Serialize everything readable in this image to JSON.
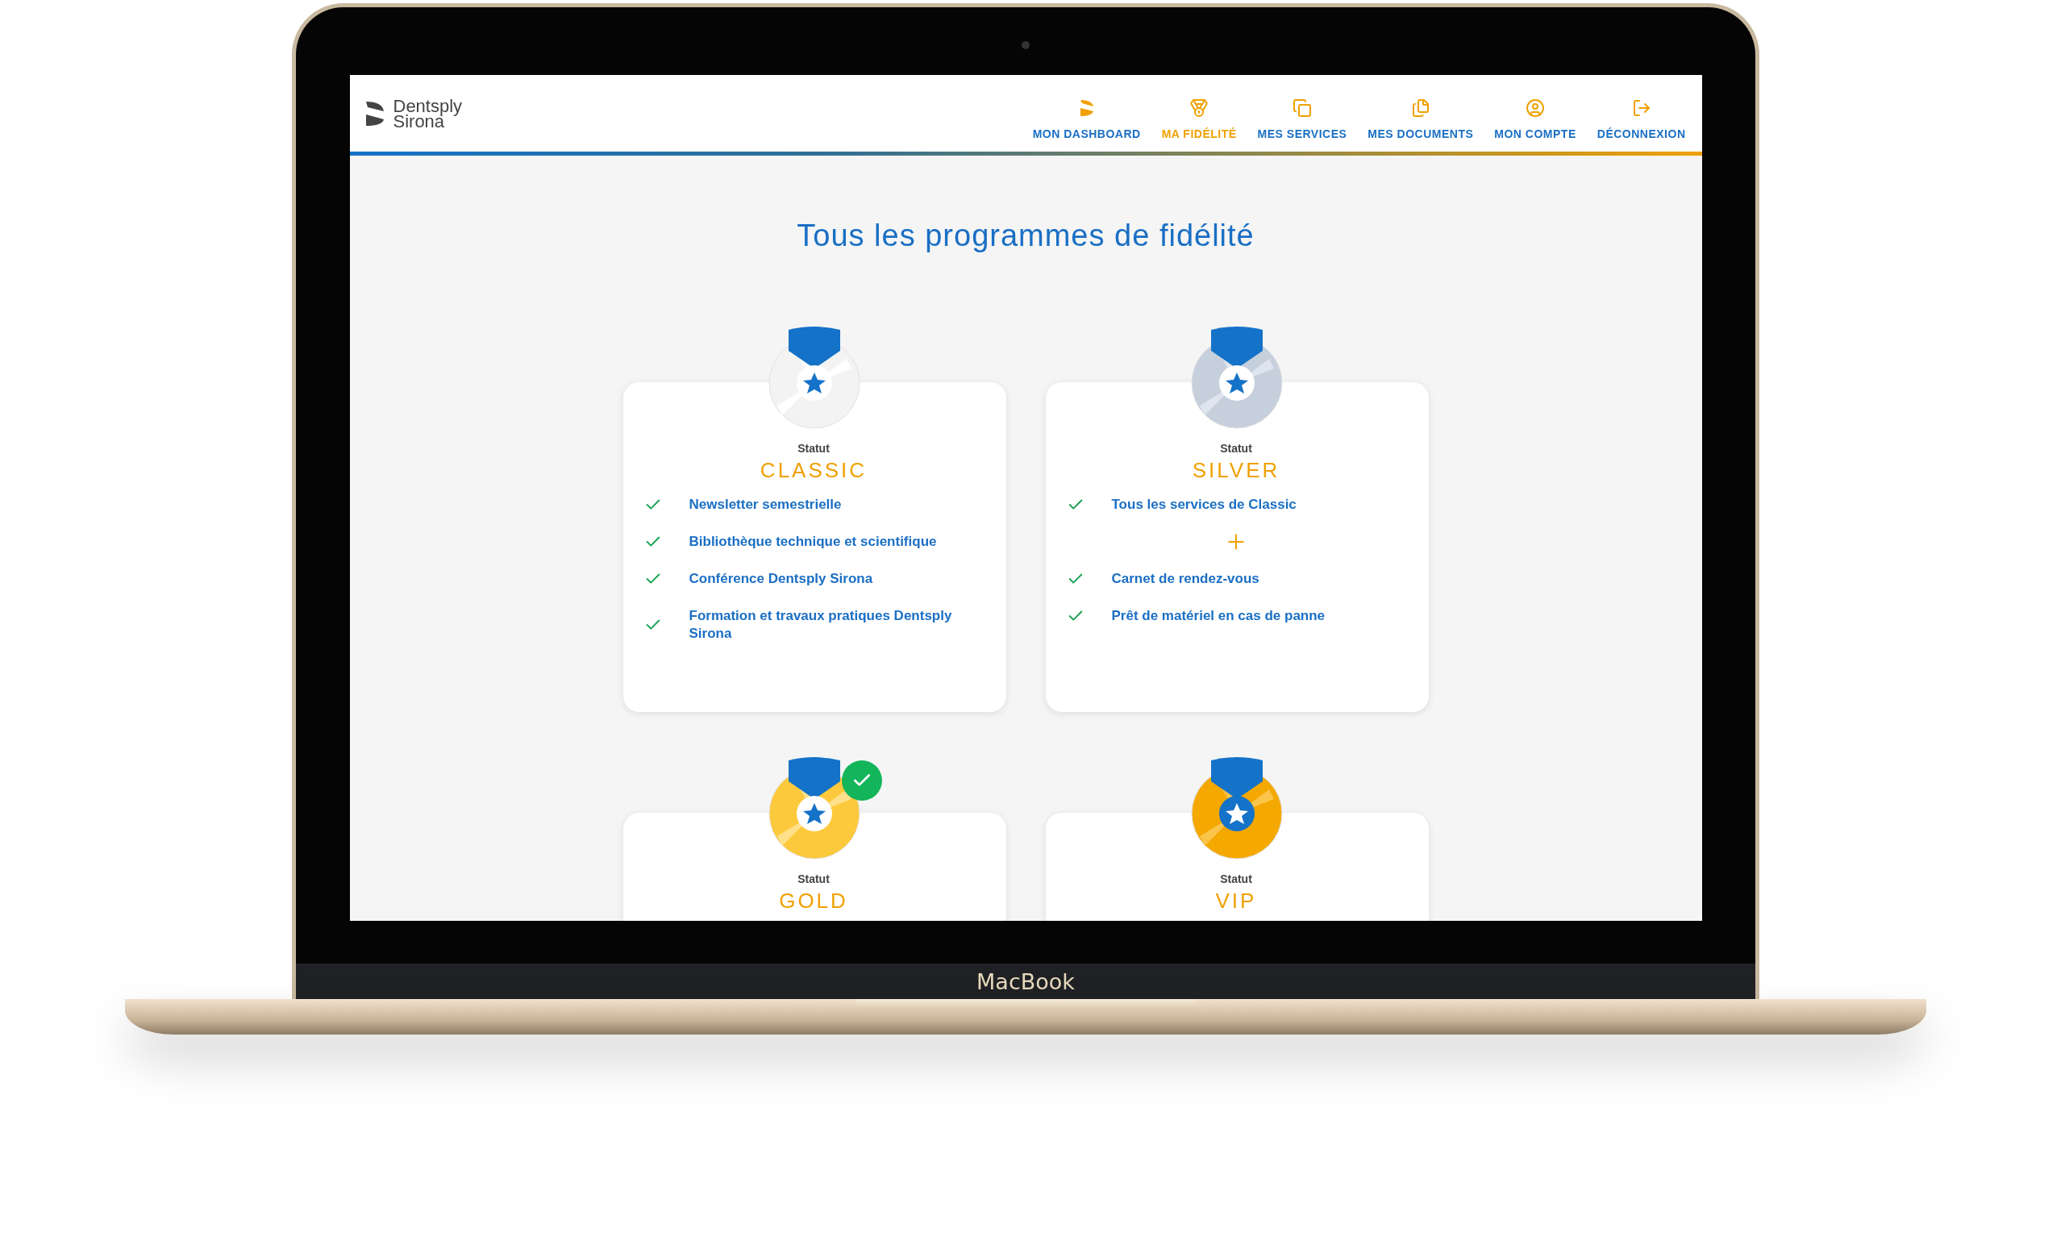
{
  "device": {
    "label": "MacBook"
  },
  "header": {
    "logo": [
      "Dentsply",
      "Sirona"
    ],
    "nav": [
      {
        "label": "MON DASHBOARD",
        "kind": "dashboard",
        "selected": false
      },
      {
        "label": "MA FIDÉLITÉ",
        "kind": "medal",
        "selected": true
      },
      {
        "label": "MES SERVICES",
        "kind": "services",
        "selected": false
      },
      {
        "label": "MES DOCUMENTS",
        "kind": "documents",
        "selected": false
      },
      {
        "label": "MON COMPTE",
        "kind": "account",
        "selected": false
      },
      {
        "label": "DÉCONNEXION",
        "kind": "logout",
        "selected": false
      }
    ]
  },
  "title": "Tous les programmes de fidélité",
  "tiers": [
    {
      "kind": "classic",
      "caption": "Statut",
      "name": "CLASSIC",
      "current": false,
      "benefits": [
        {
          "kind": "check",
          "label": "Newsletter semestrielle"
        },
        {
          "kind": "check",
          "label": "Bibliothèque technique et scientifique"
        },
        {
          "kind": "check",
          "label": "Conférence Dentsply Sirona"
        },
        {
          "kind": "check",
          "label": "Formation et travaux pratiques Dentsply Sirona"
        }
      ]
    },
    {
      "kind": "silver",
      "caption": "Statut",
      "name": "SILVER",
      "current": false,
      "benefits": [
        {
          "kind": "check",
          "label": "Tous les services de Classic"
        },
        {
          "kind": "plus"
        },
        {
          "kind": "check",
          "label": "Carnet de rendez-vous"
        },
        {
          "kind": "check",
          "label": "Prêt de matériel en cas de panne"
        }
      ]
    },
    {
      "kind": "gold",
      "caption": "Statut",
      "name": "GOLD",
      "current": true
    },
    {
      "kind": "vip",
      "caption": "Statut",
      "name": "VIP",
      "current": false
    }
  ]
}
